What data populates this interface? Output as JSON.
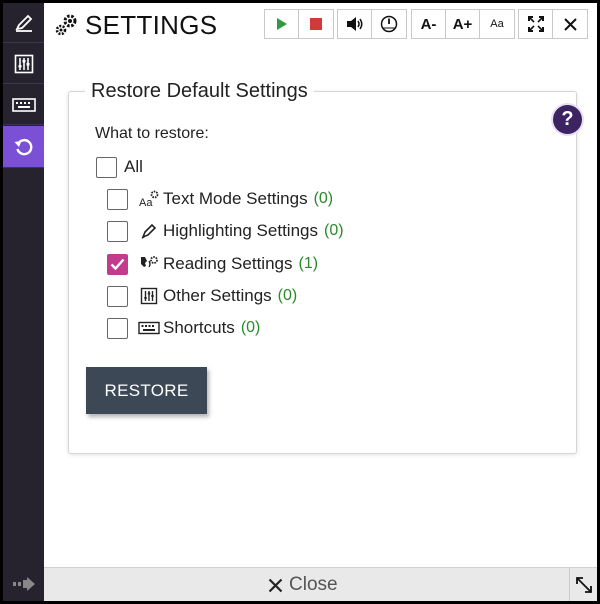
{
  "window": {
    "title": "SETTINGS",
    "title_icon": "gears-icon"
  },
  "sidebar": {
    "items": [
      {
        "name": "pencil-icon",
        "active": false
      },
      {
        "name": "sliders-icon",
        "active": false
      },
      {
        "name": "keyboard-icon",
        "active": false
      },
      {
        "name": "restore-icon",
        "active": true
      }
    ],
    "bottom_icon": "arrow-right-icon"
  },
  "toolbar": {
    "playback": [
      {
        "name": "play-icon",
        "color": "#2e9b3f"
      },
      {
        "name": "stop-icon",
        "color": "#d23a3a"
      }
    ],
    "audio": [
      {
        "name": "volume-icon"
      },
      {
        "name": "speed-icon"
      }
    ],
    "text_size": [
      {
        "label": "A-"
      },
      {
        "label": "A+"
      },
      {
        "label": "Aa"
      }
    ],
    "window_controls": [
      {
        "name": "fullscreen-icon"
      },
      {
        "name": "close-icon"
      }
    ]
  },
  "panel": {
    "legend": "Restore Default Settings",
    "help_label": "?",
    "what_label": "What to restore:",
    "all_label": "All",
    "options": [
      {
        "label": "Text Mode Settings",
        "count": "(0)",
        "checked": false,
        "icon": "text-mode-icon"
      },
      {
        "label": "Highlighting Settings",
        "count": "(0)",
        "checked": false,
        "icon": "highlighter-icon"
      },
      {
        "label": "Reading Settings",
        "count": "(1)",
        "checked": true,
        "icon": "reading-icon"
      },
      {
        "label": "Other Settings",
        "count": "(0)",
        "checked": false,
        "icon": "sliders-icon"
      },
      {
        "label": "Shortcuts",
        "count": "(0)",
        "checked": false,
        "icon": "keyboard-icon"
      }
    ],
    "restore_label": "RESTORE"
  },
  "footer": {
    "close_label": "Close"
  },
  "colors": {
    "sidebar_bg": "#26232f",
    "active": "#7b4fd6",
    "check": "#c23b8c",
    "count": "#2a8a2a",
    "button": "#3c4856"
  }
}
